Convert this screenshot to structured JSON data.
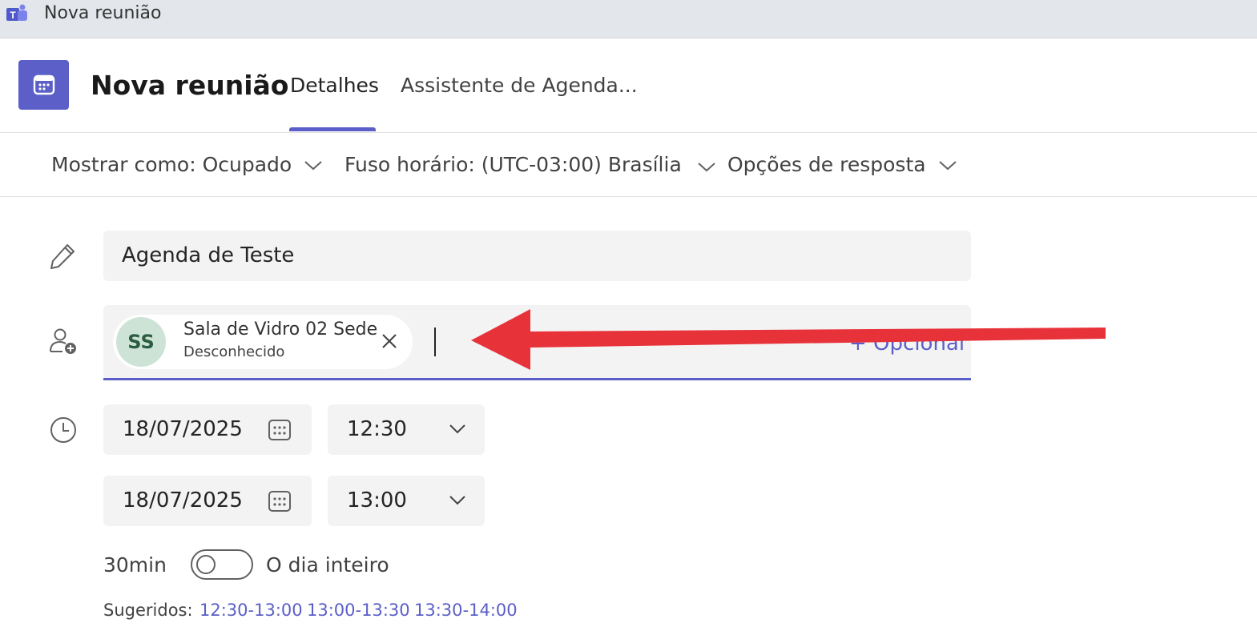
{
  "window": {
    "title": "Nova reunião"
  },
  "header": {
    "title": "Nova reunião",
    "tabs": [
      {
        "label": "Detalhes",
        "active": true
      },
      {
        "label": "Assistente de Agenda..."
      }
    ]
  },
  "options": {
    "show_as": "Mostrar como: Ocupado",
    "timezone": "Fuso horário: (UTC-03:00) Brasília",
    "response": "Opções de resposta"
  },
  "form": {
    "title_value": "Agenda de Teste",
    "attendees": [
      {
        "initials": "SS",
        "name": "Sala de Vidro 02 Sede",
        "status": "Desconhecido"
      }
    ],
    "optional_label": "+ Opcional",
    "start": {
      "date": "18/07/2025",
      "time": "12:30"
    },
    "end": {
      "date": "18/07/2025",
      "time": "13:00"
    },
    "duration": "30min",
    "all_day_label": "O dia inteiro",
    "all_day": false,
    "suggested_label": "Sugeridos:",
    "suggested_slots": [
      "12:30-13:00",
      "13:00-13:30",
      "13:30-14:00"
    ]
  },
  "colors": {
    "accent": "#5b5fc7",
    "annotation_arrow": "#e8323a",
    "avatar_bg": "#cde3d6"
  }
}
